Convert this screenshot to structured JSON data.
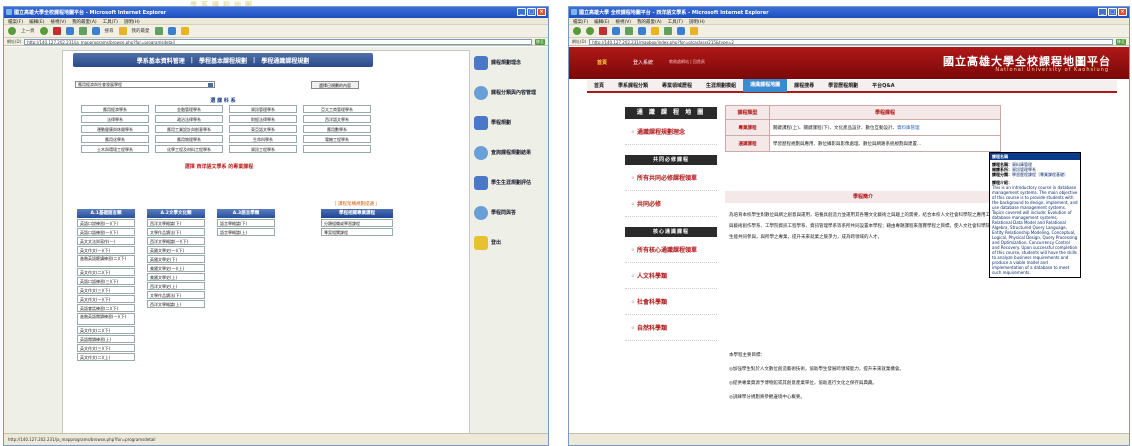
{
  "header_deco": "學系課程地圖",
  "left_window": {
    "title": "國立高雄大學全校課程地圖平台 - Microsoft Internet Explorer",
    "menu": [
      "檔案(F)",
      "編輯(E)",
      "檢視(V)",
      "我的最愛(A)",
      "工具(T)",
      "說明(H)"
    ],
    "toolbar": {
      "back": "上一頁",
      "search": "搜尋",
      "favorites": "我的最愛"
    },
    "address_label": "網址(D)",
    "address": "http://140.127.202.231/ja_mapprograms/browse.php?for=programsdetail",
    "go": "移至",
    "status": "http://140.127.202.231/ja_mapprograms/browse.php?for=programsdetail",
    "page": {
      "tabs": [
        "學系基本資料管理",
        "學程基本課程規劃",
        "學程通識課程規劃"
      ],
      "select_value": "應用經濟與社會發展學程",
      "select_button": "選擇已規劃的內容",
      "section_title": "選 課 科 系",
      "departments": [
        "應用經濟學系",
        "金融管理學系",
        "資訊管理學系",
        "亞太工商管理學系",
        "法律學系",
        "政治法律學系",
        "財經法律學系",
        "西洋語文學系",
        "運動健康與休閒學系",
        "應用工業設計與創意學系",
        "東亞語文學系",
        "應用數學系",
        "應用化學系",
        "應用物理學系",
        "生命科學系",
        "電機工程學系",
        "土木與環境工程學系",
        "化學工程及材料工程學系",
        "資訊工程學系",
        ""
      ],
      "red_note": "選擇 西洋語文學系 的專業課程",
      "orange_note": "［ 課程架構規劃提議 ］",
      "columns": [
        {
          "head": "A.1基礎語言類",
          "items": [
            "英語口說練習(一)(下)",
            "英語口語練習(一)(下)",
            "英文文法與寫作(一)",
            "英文作文(一)(下)",
            "進階英語聽講練習(二)(下)",
            "英文作文(二)(下)",
            "英語口語練習(三)(下)",
            "英文作文(三)(下)",
            "英文作文(一)(下)",
            "英語會話練習(二)(下)",
            "進階英語閱讀練習(一)(下)",
            "英文作文(二)(下)",
            "英語閱讀練習(上)",
            "英文作文(三)(下)",
            "英文作文(二)(上)"
          ]
        },
        {
          "head": "A.2文學文化類",
          "items": [
            "西洋文學概論(下)",
            "文學作品讀法(下)",
            "西洋文學概論(一)(下)",
            "英國文學史(一)(下)",
            "英國文學史(下)",
            "美國文學史(一)(上)",
            "美國文學史(上)",
            "西洋文學史(上)",
            "文學作品讀法(下)",
            "西洋文學概論(上)"
          ]
        },
        {
          "head": "A.3語言學類",
          "items": [
            "語言學概論(下)",
            "語言學概論(上)"
          ]
        }
      ],
      "program_head": "學程相關專業課程",
      "program_items": [
        "分類組織或學習課程",
        "專案相關課程"
      ]
    },
    "right_panel": [
      "課程規劃理念",
      "課程分類與內容管理",
      "學程規劃",
      "查詢課程規劃結果",
      "學生生涯規劃評估",
      "學程問與答",
      "登出"
    ]
  },
  "right_window": {
    "title": "國立高雄大學 全校課程地圖平台 - 西洋語文學系 - Microsoft Internet Explorer",
    "menu": [
      "檔案(F)",
      "編輯(E)",
      "檢視(V)",
      "我的最愛(A)",
      "工具(T)",
      "說明(H)"
    ],
    "address_label": "網址(D)",
    "address": "http://140.127.202.231/mapbox/index.php?for=plcaclassr215&type=2",
    "go": "移至",
    "status": "",
    "page": {
      "home": "首頁",
      "login": "登入系統",
      "small": "教務處網站 | 回首頁",
      "site_title": "國立高雄大學全校課程地圖平台",
      "site_sub": "National University of Kaohsiung",
      "nav": [
        "首頁",
        "學系課程分類",
        "專業領域歷程",
        "生涯規劃模組",
        "通識課程地圖",
        "課程搜尋",
        "學習歷程規劃",
        "平台Q&A"
      ],
      "nav_active": 4,
      "left": {
        "head": "通 識 課 程 地 圖",
        "link1": "通識課程規劃理念",
        "sub1": "共同必修課程",
        "link2": "所有共同必修課程領單",
        "link3": "共同必修",
        "sub2": "核心通識課程",
        "link4": "所有核心通識課程領單",
        "link5": "人文科學類",
        "link6": "社會科學類",
        "link7": "自然科學類"
      },
      "table": {
        "head_k": "課程類型",
        "head_v": "學程課程",
        "rows": [
          {
            "k": "專業課程",
            "v": "關鍵課程(上)、關鍵課程(下)、文化產品設計、數位互動設計、",
            "link": "資料庫管理"
          },
          {
            "k": "通識課程",
            "v": "學習歷程規劃與應用、數位攝影與影像處理、數位與網路系統規劃與建置...",
            "link": ""
          }
        ]
      },
      "intro_head": "學程簡介",
      "desc": "為培育本校學生對數位與網之創意與運用，培養具創造力並運用其各種文化藝術之與趣上的需要，結合本校人文社會科學院之應用工程與藝術創作學系、工學院資訊工程學系、資訊管理學系等系所共同設置本學程；藉由專題課程來落實學程之目標，使人文社會科學院學生能共同參與，與所學之專業，提升未來就業之競爭力，成為跨領域的人才。",
      "goal_head": "本學程主要目標：",
      "goals": [
        "◎加強學生對於人文數位創造藝術技術，協助學生發展跨領域能力，提升未來就業機會。",
        "◎提供專業資源予博物館或其創意產業單位，協助進行文化之保存與典藏。",
        "◎訓練學分規劃將參觀邊境中心概要。"
      ],
      "popup": {
        "title": "課程名稱",
        "l1_k": "課程名稱：",
        "l1_v": "資料庫管理",
        "l2_k": "開課系所：",
        "l2_v": "資訊管理學系",
        "l3_k": "課程分類：",
        "l3_v": "學習歷程課程（專業課程基礎）",
        "l4_k": "課程介紹：",
        "text": "This is an introductory course in database management systems. The main objective of this course is to provide students with the background to design, implement, and use database management systems. Topics covered will include: Evolution of database management systems, Relational Data Model and Relational Algebra, Structured Query Language, Entity Relationship Modeling, Conceptual, Logical, Physical Design, Query Processing and Optimization, Concurrency Control and Recovery. Upon successful completion of this course, students will have the skills to analyze business requirements and produce a viable model and implementation of a database to meet such requirements."
      }
    }
  }
}
